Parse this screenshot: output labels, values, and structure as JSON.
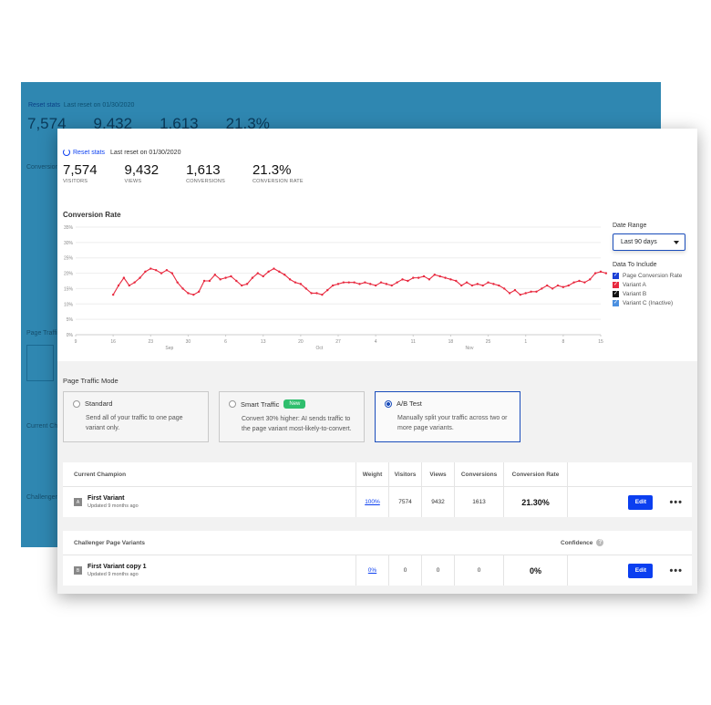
{
  "reset": {
    "link_label": "Reset stats",
    "note": "Last reset on 01/30/2020"
  },
  "stats": [
    {
      "value": "7,574",
      "label": "VISITORS"
    },
    {
      "value": "9,432",
      "label": "VIEWS"
    },
    {
      "value": "1,613",
      "label": "CONVERSIONS"
    },
    {
      "value": "21.3%",
      "label": "CONVERSION RATE"
    }
  ],
  "chart_data": {
    "type": "line",
    "title": "Conversion Rate",
    "y_ticks": [
      "35%",
      "30%",
      "25%",
      "20%",
      "15%",
      "10%",
      "5%",
      "0%"
    ],
    "ylim": [
      0,
      35
    ],
    "x_ticks": [
      "9",
      "16",
      "23",
      "30",
      "6",
      "13",
      "20",
      "27",
      "4",
      "11",
      "18",
      "25",
      "1",
      "8",
      "15"
    ],
    "month_labels": [
      {
        "label": "Sep",
        "after_tick": 3
      },
      {
        "label": "Oct",
        "after_tick": 7
      },
      {
        "label": "Nov",
        "after_tick": 11
      }
    ],
    "x_range": [
      9,
      107
    ],
    "grid": true,
    "series": [
      {
        "color": "#e8293f",
        "values": [
          [
            16,
            13
          ],
          [
            17,
            16
          ],
          [
            18,
            18.5
          ],
          [
            19,
            16
          ],
          [
            20,
            17
          ],
          [
            21,
            18.5
          ],
          [
            22,
            20.5
          ],
          [
            23,
            21.5
          ],
          [
            24,
            21
          ],
          [
            25,
            20
          ],
          [
            26,
            21
          ],
          [
            27,
            20
          ],
          [
            28,
            17
          ],
          [
            29,
            15
          ],
          [
            30,
            13.5
          ],
          [
            31,
            13
          ],
          [
            32,
            14
          ],
          [
            33,
            17.5
          ],
          [
            34,
            17.5
          ],
          [
            35,
            19.5
          ],
          [
            36,
            18
          ],
          [
            37,
            18.5
          ],
          [
            38,
            19
          ],
          [
            39,
            17.5
          ],
          [
            40,
            16
          ],
          [
            41,
            16.5
          ],
          [
            42,
            18.5
          ],
          [
            43,
            20
          ],
          [
            44,
            19
          ],
          [
            45,
            20.5
          ],
          [
            46,
            21.5
          ],
          [
            47,
            20.5
          ],
          [
            48,
            19.5
          ],
          [
            49,
            18
          ],
          [
            50,
            17
          ],
          [
            51,
            16.5
          ],
          [
            52,
            15
          ],
          [
            53,
            13.5
          ],
          [
            54,
            13.5
          ],
          [
            55,
            13
          ],
          [
            56,
            14.5
          ],
          [
            57,
            16
          ],
          [
            58,
            16.5
          ],
          [
            59,
            17
          ],
          [
            60,
            17
          ],
          [
            61,
            17
          ],
          [
            62,
            16.5
          ],
          [
            63,
            17
          ],
          [
            64,
            16.5
          ],
          [
            65,
            16
          ],
          [
            66,
            17
          ],
          [
            67,
            16.5
          ],
          [
            68,
            16
          ],
          [
            69,
            17
          ],
          [
            70,
            18
          ],
          [
            71,
            17.5
          ],
          [
            72,
            18.5
          ],
          [
            73,
            18.5
          ],
          [
            74,
            19
          ],
          [
            75,
            18
          ],
          [
            76,
            19.5
          ],
          [
            77,
            19
          ],
          [
            78,
            18.5
          ],
          [
            79,
            18
          ],
          [
            80,
            17.5
          ],
          [
            81,
            16
          ],
          [
            82,
            17
          ],
          [
            83,
            16
          ],
          [
            84,
            16.5
          ],
          [
            85,
            16
          ],
          [
            86,
            17
          ],
          [
            87,
            16.5
          ],
          [
            88,
            16
          ],
          [
            89,
            15
          ],
          [
            90,
            13.5
          ],
          [
            91,
            14.5
          ],
          [
            92,
            13
          ],
          [
            93,
            13.5
          ],
          [
            94,
            14
          ],
          [
            95,
            14
          ],
          [
            96,
            15
          ],
          [
            97,
            16
          ],
          [
            98,
            15
          ],
          [
            99,
            16
          ],
          [
            100,
            15.5
          ],
          [
            101,
            16
          ],
          [
            102,
            17
          ],
          [
            103,
            17.5
          ],
          [
            104,
            17
          ],
          [
            105,
            18
          ],
          [
            106,
            20
          ],
          [
            107,
            20.5
          ],
          [
            108,
            20
          ]
        ]
      }
    ]
  },
  "side": {
    "date_range_heading": "Date Range",
    "date_range_value": "Last 90 days",
    "data_include_heading": "Data To Include",
    "items": [
      {
        "label": "Page Conversion Rate",
        "color": "#1a3fd6"
      },
      {
        "label": "Variant A",
        "color": "#e8293f"
      },
      {
        "label": "Variant B",
        "color": "#111111"
      },
      {
        "label": "Variant C (Inactive)",
        "color": "#4a8fe0"
      }
    ]
  },
  "traffic": {
    "title": "Page Traffic Mode",
    "options": [
      {
        "name": "Standard",
        "desc": "Send all of your traffic to one page variant only."
      },
      {
        "name": "Smart Traffic",
        "badge": "New",
        "desc": "Convert 30% higher: AI sends traffic to the page variant most-likely-to-convert."
      },
      {
        "name": "A/B Test",
        "desc": "Manually split your traffic across two or more page variants."
      }
    ]
  },
  "champion": {
    "headers": {
      "title": "Current Champion",
      "weight": "Weight",
      "visitors": "Visitors",
      "views": "Views",
      "conversions": "Conversions",
      "rate": "Conversion Rate"
    },
    "row": {
      "icon": "A",
      "name": "First Variant",
      "updated": "Updated 9 months ago",
      "weight": "100%",
      "visitors": "7574",
      "views": "9432",
      "conversions": "1613",
      "rate": "21.30%",
      "edit": "Edit"
    }
  },
  "challenger": {
    "headers": {
      "title": "Challenger Page Variants",
      "confidence": "Confidence"
    },
    "row": {
      "icon": "B",
      "name": "First Variant copy 1",
      "updated": "Updated 9 months ago",
      "weight": "0%",
      "visitors": "0",
      "views": "0",
      "conversions": "0",
      "rate": "0%",
      "edit": "Edit"
    }
  }
}
